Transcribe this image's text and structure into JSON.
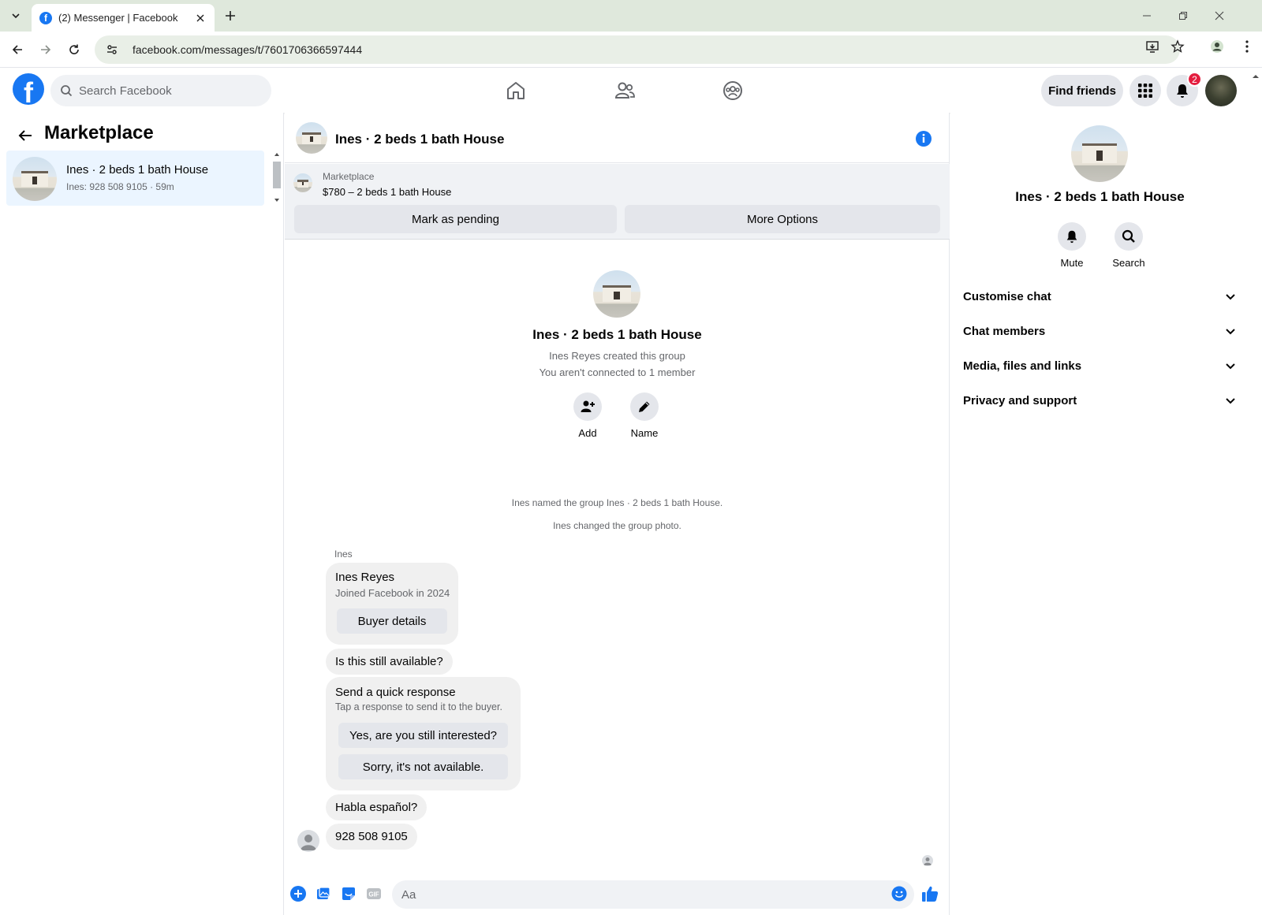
{
  "browser": {
    "tab_title": "(2) Messenger | Facebook",
    "url": "facebook.com/messages/t/7601706366597444"
  },
  "header": {
    "search_placeholder": "Search Facebook",
    "find_friends": "Find friends",
    "notification_count": "2",
    "brand_color": "#1877f2"
  },
  "left": {
    "title": "Marketplace",
    "conversations": [
      {
        "name": "Ines · 2 beds 1 bath House",
        "preview": "Ines: 928 508 9105 · 59m"
      }
    ]
  },
  "chat": {
    "title": "Ines · 2 beds 1 bath House",
    "marketplace_label": "Marketplace",
    "listing": "$780 – 2 beds 1 bath House",
    "mark_pending": "Mark as pending",
    "more_options": "More Options",
    "intro": {
      "group_name": "Ines · 2 beds 1 bath House",
      "created": "Ines Reyes created this group",
      "connection": "You aren't connected to 1 member",
      "add_label": "Add",
      "name_label": "Name"
    },
    "system_messages": [
      "Ines named the group Ines · 2 beds 1 bath House.",
      "Ines changed the group photo."
    ],
    "sender_name": "Ines",
    "profile_card": {
      "name": "Ines Reyes",
      "joined": "Joined Facebook in 2024",
      "button": "Buyer details"
    },
    "msg_available": "Is this still available?",
    "quick_response": {
      "title": "Send a quick response",
      "subtitle": "Tap a response to send it to the buyer.",
      "option1": "Yes, are you still interested?",
      "option2": "Sorry, it's not available."
    },
    "msg_spanish": "Habla español?",
    "msg_phone": "928 508 9105",
    "composer_placeholder": "Aa"
  },
  "right": {
    "name": "Ines · 2 beds 1 bath House",
    "mute": "Mute",
    "search": "Search",
    "sections": [
      "Customise chat",
      "Chat members",
      "Media, files and links",
      "Privacy and support"
    ]
  }
}
